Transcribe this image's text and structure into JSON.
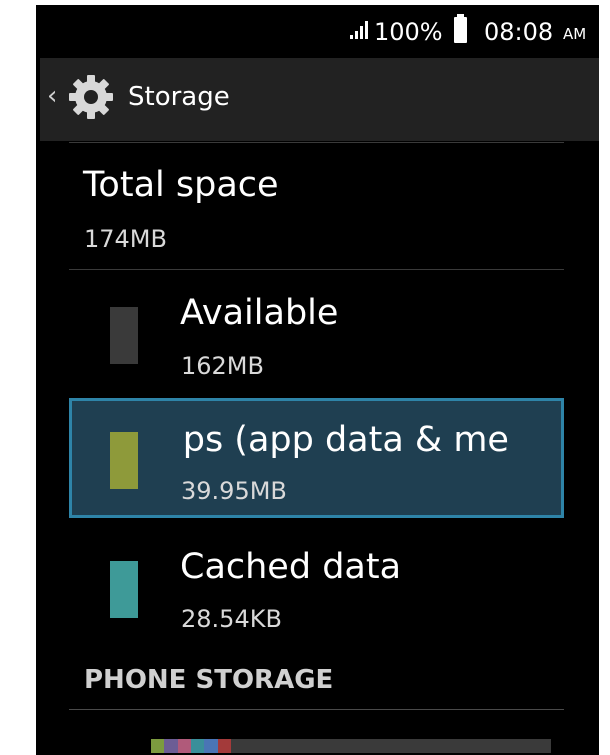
{
  "status_bar": {
    "battery_percent": "100%",
    "time": "08:08",
    "ampm": "AM"
  },
  "action_bar": {
    "back_icon": "chevron-left-icon",
    "app_icon": "gear-icon",
    "title": "Storage"
  },
  "total_space": {
    "title": "Total space",
    "summary": "174MB"
  },
  "items": [
    {
      "title": "Available",
      "summary": "162MB",
      "color": "#3a3a3a"
    },
    {
      "title": "Apps (app data & media content)",
      "visible_title": "ıps (app data & me",
      "summary": "39.95MB",
      "color": "#8e9a3a",
      "selected": true
    },
    {
      "title": "Cached data",
      "summary": "28.54KB",
      "color": "#3e9a98"
    }
  ],
  "section_header": "PHONE STORAGE",
  "usage_bar_colors": [
    "#7c9b3f",
    "#6c5d95",
    "#b05a7a",
    "#3a8f9a",
    "#4a75b5",
    "#a33a3a"
  ],
  "usage_bar_fraction": 0.2
}
